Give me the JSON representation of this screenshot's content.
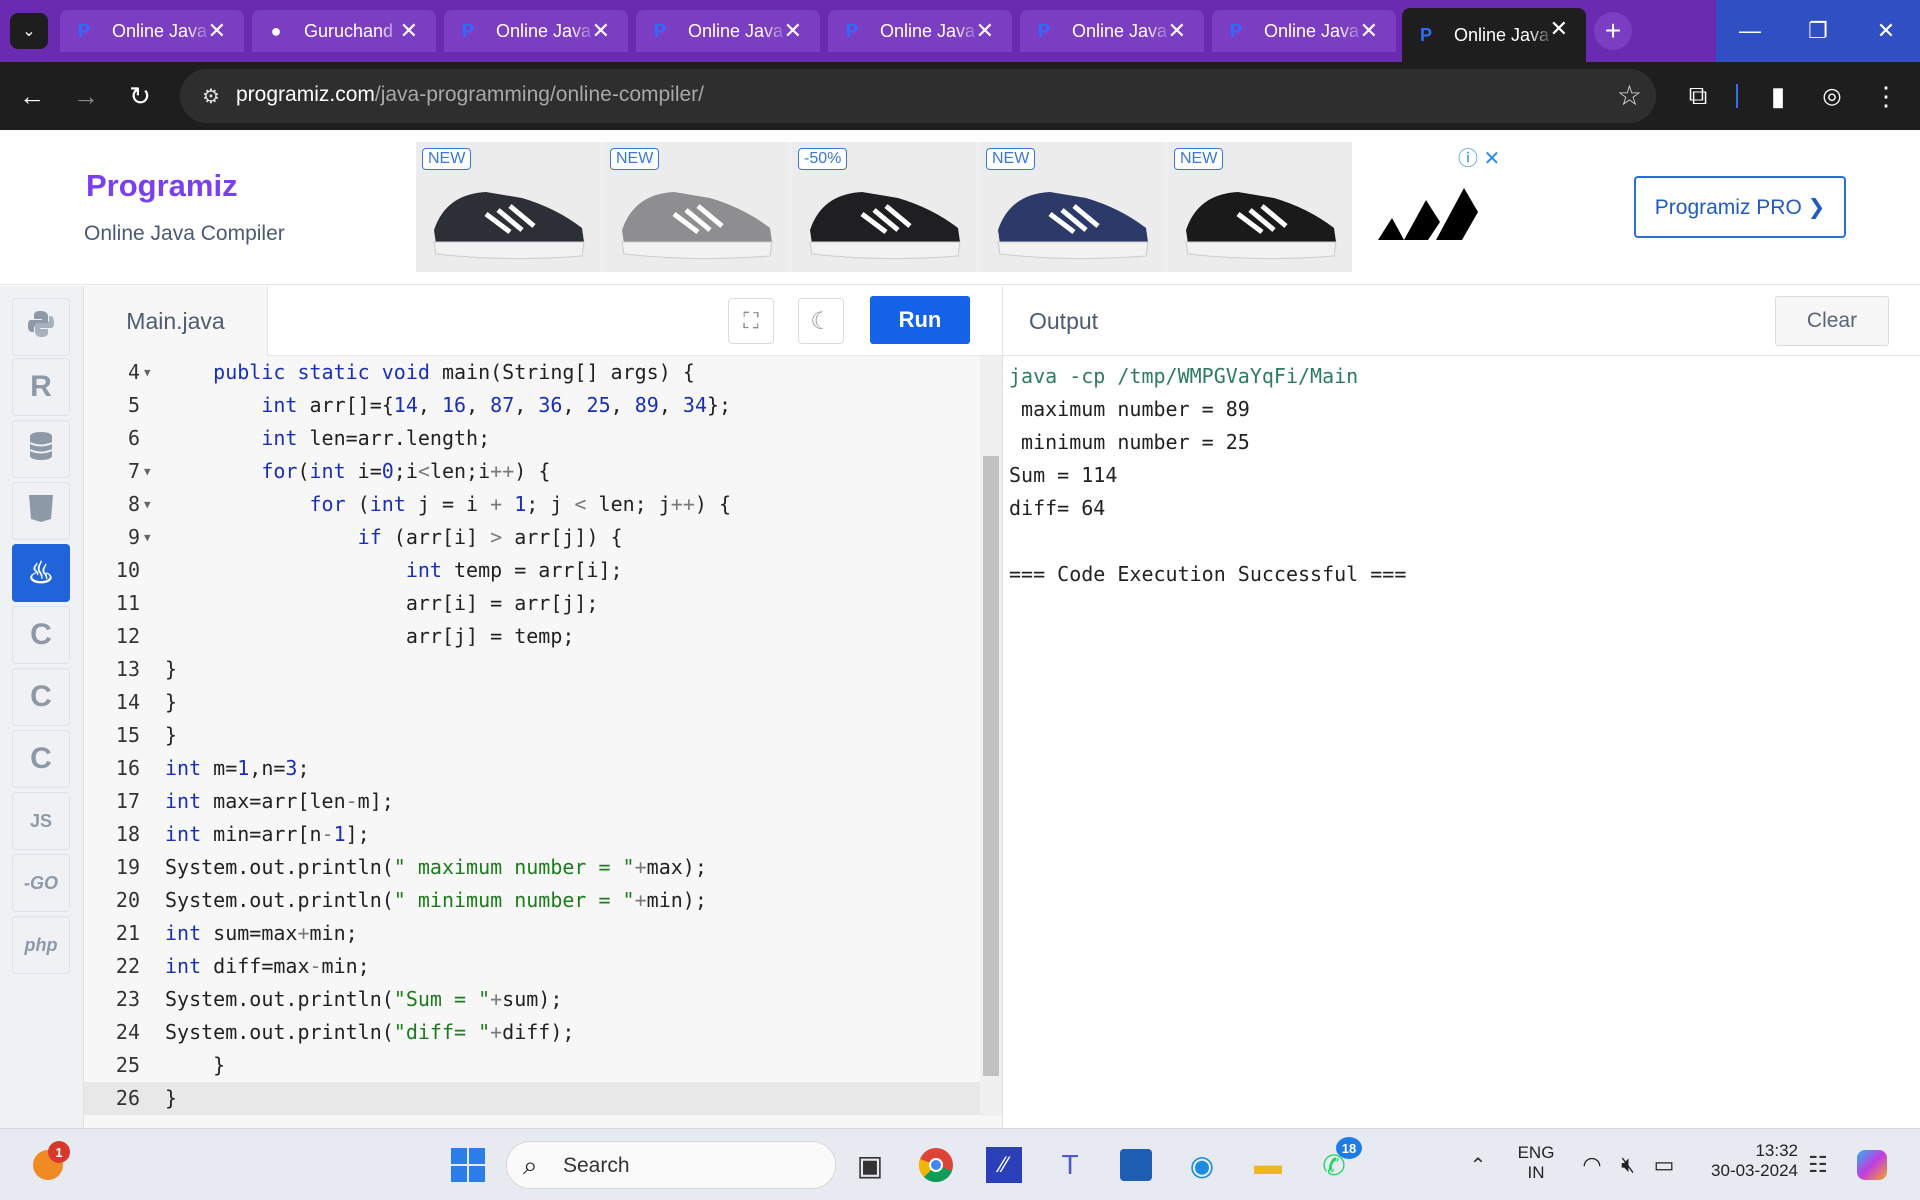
{
  "browser": {
    "tabs": [
      {
        "title": "Online Java Compiler",
        "icon": "programiz-icon",
        "active": false
      },
      {
        "title": "Guruchand",
        "icon": "github-icon",
        "active": false
      },
      {
        "title": "Online Java Compiler",
        "icon": "programiz-icon",
        "active": false
      },
      {
        "title": "Online Java Compiler",
        "icon": "programiz-icon",
        "active": false
      },
      {
        "title": "Online Java Compiler",
        "icon": "programiz-icon",
        "active": false
      },
      {
        "title": "Online Java Compiler",
        "icon": "programiz-icon",
        "active": false
      },
      {
        "title": "Online Java Compiler",
        "icon": "programiz-icon",
        "active": false
      },
      {
        "title": "Online Java Compiler",
        "icon": "programiz-icon",
        "active": true
      }
    ],
    "url_domain": "programiz.com",
    "url_path": "/java-programming/online-compiler/"
  },
  "header": {
    "logo": "Programiz",
    "subtitle": "Online Java Compiler",
    "pro_button": "Programiz PRO ❯"
  },
  "ad": {
    "tags": [
      "NEW",
      "NEW",
      "-50%",
      "NEW",
      "NEW"
    ]
  },
  "sidebar": {
    "languages": [
      {
        "name": "python",
        "label": ""
      },
      {
        "name": "r",
        "label": "R"
      },
      {
        "name": "sql",
        "label": ""
      },
      {
        "name": "html",
        "label": "5"
      },
      {
        "name": "java",
        "label": "♨",
        "active": true
      },
      {
        "name": "c",
        "label": "C"
      },
      {
        "name": "cpp",
        "label": "C"
      },
      {
        "name": "csharp",
        "label": "C"
      },
      {
        "name": "js",
        "label": "JS"
      },
      {
        "name": "go",
        "label": "-GO"
      },
      {
        "name": "php",
        "label": "php"
      }
    ]
  },
  "editor": {
    "file_tab": "Main.java",
    "run_label": "Run",
    "lines": [
      {
        "n": "4",
        "fold": true,
        "text": "    public static void main(String[] args) {"
      },
      {
        "n": "5",
        "fold": false,
        "text": "        int arr[]={14, 16, 87, 36, 25, 89, 34};"
      },
      {
        "n": "6",
        "fold": false,
        "text": "        int len=arr.length;"
      },
      {
        "n": "7",
        "fold": true,
        "text": "        for(int i=0;i<len;i++) {"
      },
      {
        "n": "8",
        "fold": true,
        "text": "            for (int j = i + 1; j < len; j++) {"
      },
      {
        "n": "9",
        "fold": true,
        "text": "                if (arr[i] > arr[j]) {"
      },
      {
        "n": "10",
        "fold": false,
        "text": "                    int temp = arr[i];"
      },
      {
        "n": "11",
        "fold": false,
        "text": "                    arr[i] = arr[j];"
      },
      {
        "n": "12",
        "fold": false,
        "text": "                    arr[j] = temp;"
      },
      {
        "n": "13",
        "fold": false,
        "text": "}"
      },
      {
        "n": "14",
        "fold": false,
        "text": "}"
      },
      {
        "n": "15",
        "fold": false,
        "text": "}"
      },
      {
        "n": "16",
        "fold": false,
        "text": "int m=1,n=3;"
      },
      {
        "n": "17",
        "fold": false,
        "text": "int max=arr[len-m];"
      },
      {
        "n": "18",
        "fold": false,
        "text": "int min=arr[n-1];"
      },
      {
        "n": "19",
        "fold": false,
        "text": "System.out.println(\" maximum number = \"+max);"
      },
      {
        "n": "20",
        "fold": false,
        "text": "System.out.println(\" minimum number = \"+min);"
      },
      {
        "n": "21",
        "fold": false,
        "text": "int sum=max+min;"
      },
      {
        "n": "22",
        "fold": false,
        "text": "int diff=max-min;"
      },
      {
        "n": "23",
        "fold": false,
        "text": "System.out.println(\"Sum = \"+sum);"
      },
      {
        "n": "24",
        "fold": false,
        "text": "System.out.println(\"diff= \"+diff);"
      },
      {
        "n": "25",
        "fold": false,
        "text": "    }"
      },
      {
        "n": "26",
        "fold": false,
        "text": "}"
      }
    ]
  },
  "output": {
    "title": "Output",
    "clear_label": "Clear",
    "command": "java -cp /tmp/WMPGVaYqFi/Main",
    "lines": [
      " maximum number = 89",
      " minimum number = 25",
      "Sum = 114",
      "diff= 64",
      "",
      "=== Code Execution Successful ==="
    ]
  },
  "taskbar": {
    "search_placeholder": "Search",
    "notification_count": "1",
    "whatsapp_count": "18",
    "lang_top": "ENG",
    "lang_bottom": "IN",
    "time": "13:32",
    "date": "30-03-2024"
  }
}
